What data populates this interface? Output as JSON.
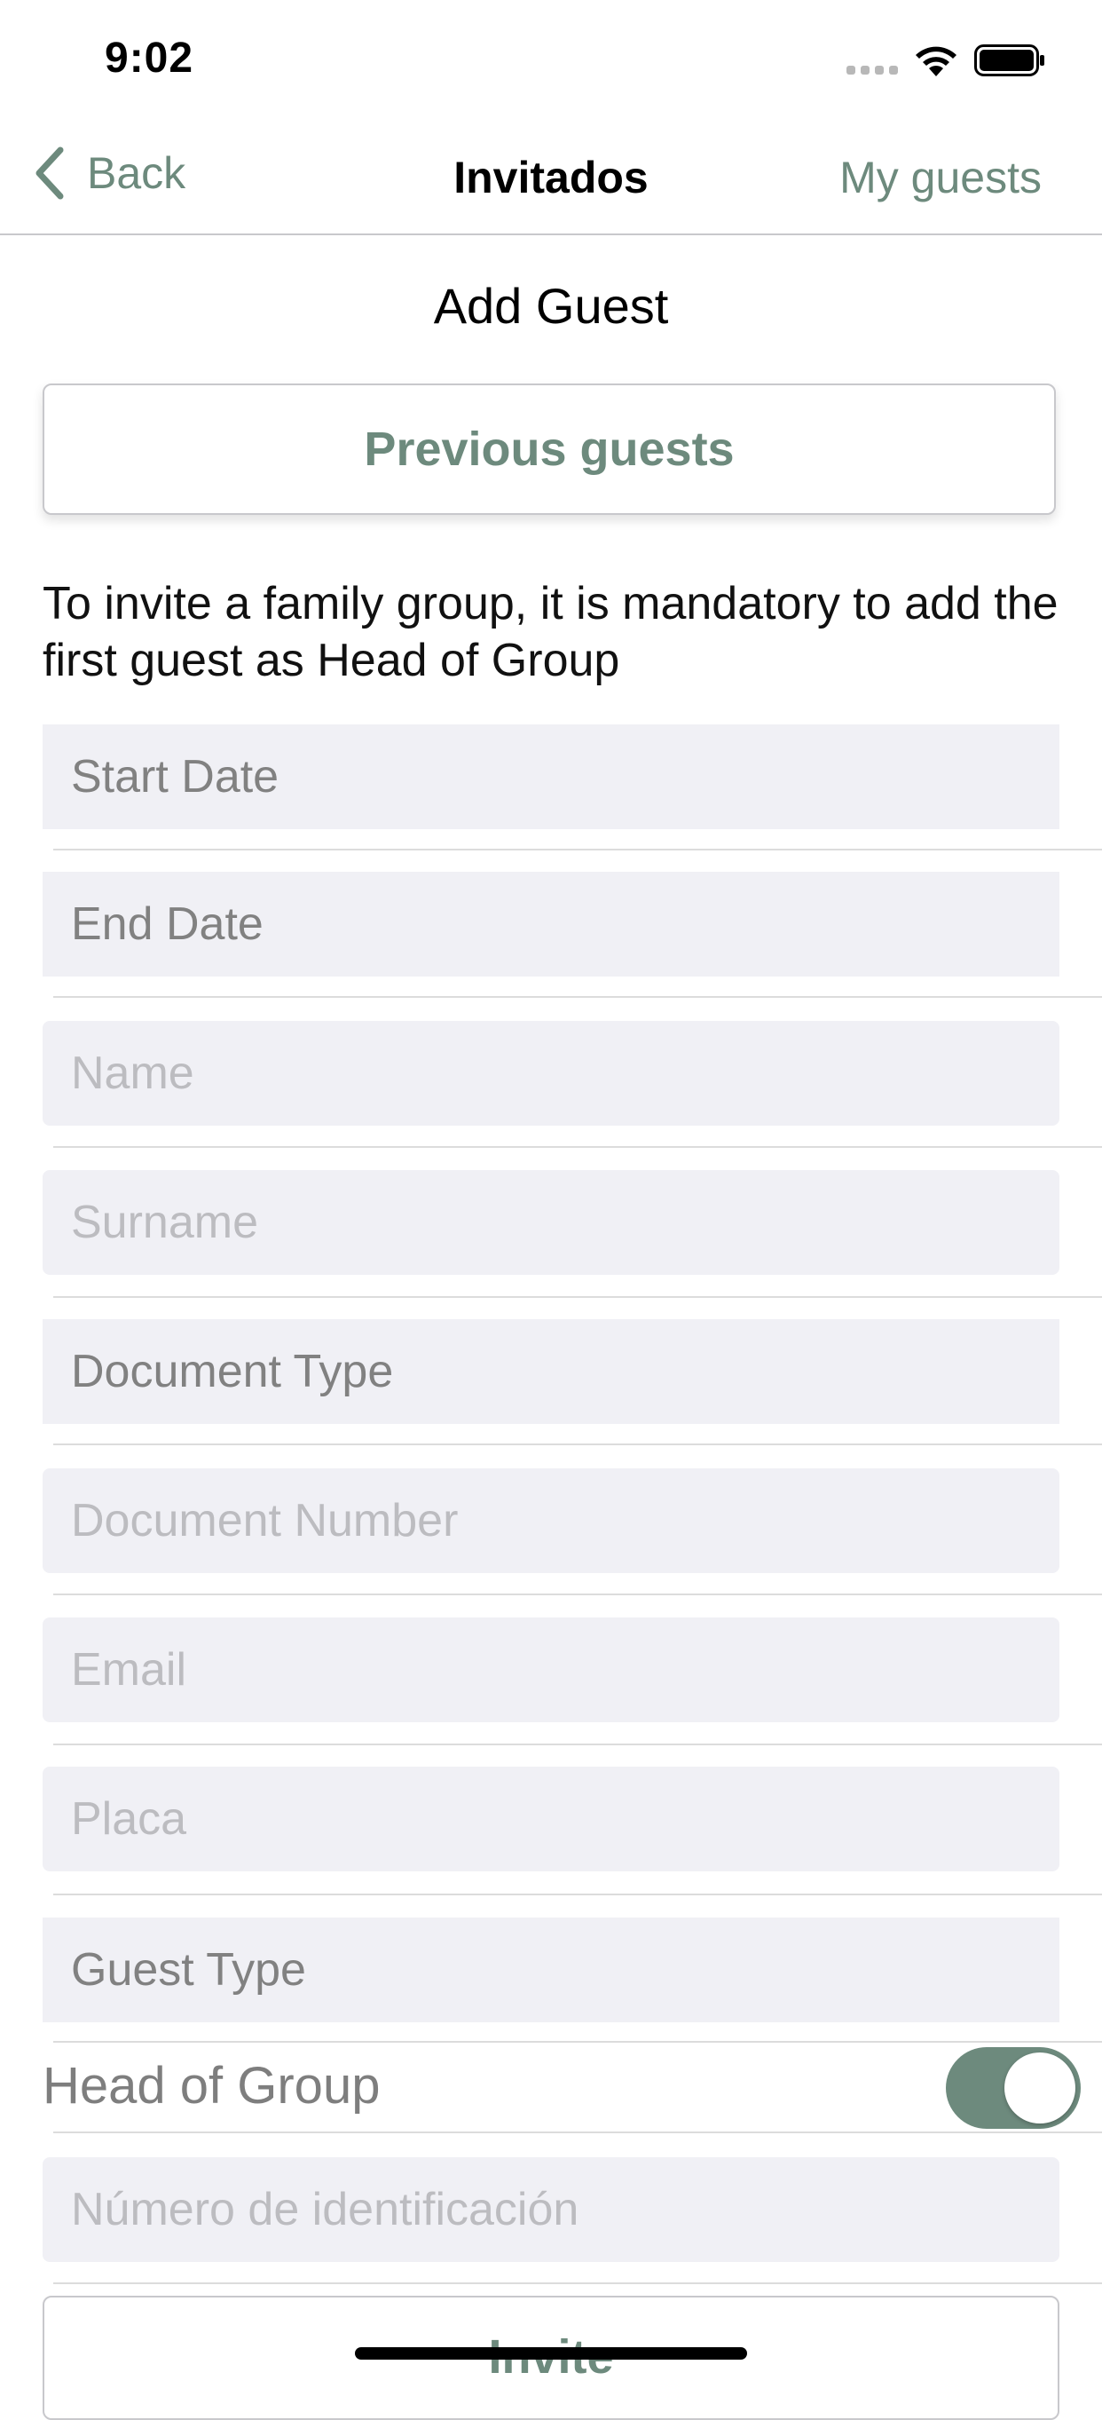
{
  "status_bar": {
    "time": "9:02"
  },
  "nav": {
    "back_label": "Back",
    "title": "Invitados",
    "right_label": "My guests"
  },
  "page": {
    "heading": "Add Guest",
    "previous_guests_label": "Previous guests",
    "info_text": "To invite a family group, it is mandatory to add the first guest as Head of Group"
  },
  "fields": {
    "start_date": "Start Date",
    "end_date": "End Date",
    "name_placeholder": "Name",
    "surname_placeholder": "Surname",
    "document_type": "Document Type",
    "document_number_placeholder": "Document Number",
    "email_placeholder": "Email",
    "placa_placeholder": "Placa",
    "guest_type": "Guest Type",
    "head_of_group_label": "Head of Group",
    "head_of_group_on": true,
    "id_number_placeholder": "Número de identificación"
  },
  "actions": {
    "invite_label": "Invite"
  },
  "colors": {
    "accent": "#6d8a7d",
    "field_bg": "#f0f0f5"
  }
}
